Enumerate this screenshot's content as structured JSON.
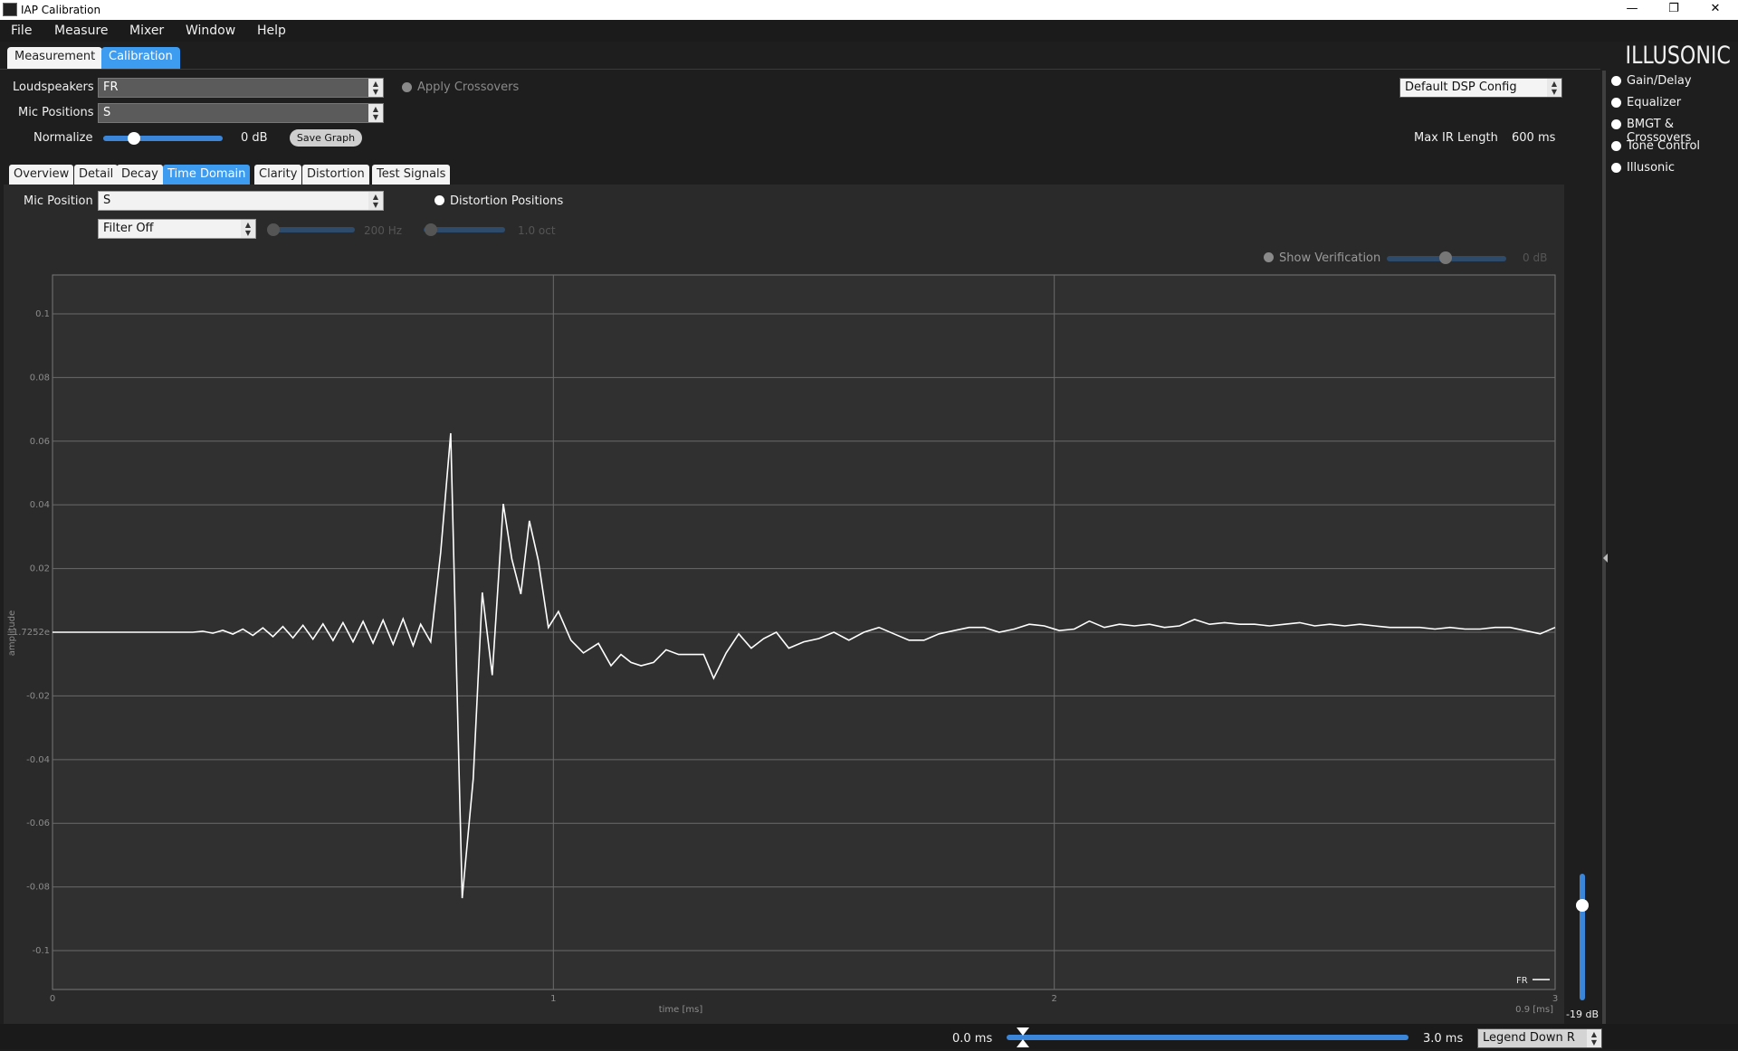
{
  "window": {
    "title": "IAP Calibration"
  },
  "menu": [
    "File",
    "Measure",
    "Mixer",
    "Window",
    "Help"
  ],
  "main_tabs": [
    "Measurement",
    "Calibration"
  ],
  "brand": "ILLUSONIC",
  "controls": {
    "loudspeakers_label": "Loudspeakers",
    "loudspeakers_value": "FR",
    "mic_positions_label": "Mic Positions",
    "mic_positions_value": "S",
    "apply_crossovers": "Apply Crossovers",
    "normalize_label": "Normalize",
    "normalize_value": "0 dB",
    "save_graph": "Save Graph",
    "dsp_config": "Default DSP Config",
    "max_ir_label": "Max IR Length",
    "max_ir_value": "600 ms"
  },
  "sub_tabs": [
    "Overview",
    "Detail",
    "Decay",
    "Time Domain",
    "Clarity",
    "Distortion",
    "Test Signals"
  ],
  "time_domain": {
    "mic_position_label": "Mic Position",
    "mic_position_value": "S",
    "distortion_positions": "Distortion Positions",
    "filter_value": "Filter Off",
    "freq_value": "200 Hz",
    "oct_value": "1.0 oct",
    "show_verification": "Show Verification",
    "verification_db": "0 dB"
  },
  "side_panel": [
    "Gain/Delay",
    "Equalizer",
    "BMGT & Crossovers",
    "Tone Control",
    "Illusonic"
  ],
  "vertical_slider_value": "-19 dB",
  "bottom": {
    "start": "0.0 ms",
    "end": "3.0 ms",
    "legend_select": "Legend Down R"
  },
  "chart_data": {
    "type": "line",
    "title": "",
    "xlabel": "time [ms]",
    "ylabel": "amplitude",
    "xlim": [
      0,
      3
    ],
    "ylim": [
      -0.1122,
      0.1122
    ],
    "x_ticks": [
      "0",
      "1",
      "2",
      "3"
    ],
    "y_ticks": [
      "0.1",
      "0.08",
      "0.06",
      "0.04",
      "0.02",
      "-1.7252e",
      "-0.02",
      "-0.04",
      "-0.06",
      "-0.08",
      "-0.1"
    ],
    "corner_label": "0.9 [ms]",
    "legend": [
      "FR"
    ],
    "series": [
      {
        "name": "FR",
        "points": [
          [
            0.0,
            0.0
          ],
          [
            0.04,
            0.0
          ],
          [
            0.08,
            0.0
          ],
          [
            0.12,
            0.0
          ],
          [
            0.16,
            0.0
          ],
          [
            0.2,
            0.0
          ],
          [
            0.24,
            0.0
          ],
          [
            0.28,
            0.0
          ],
          [
            0.3,
            0.0003
          ],
          [
            0.32,
            -0.0003
          ],
          [
            0.34,
            0.0006
          ],
          [
            0.36,
            -0.0006
          ],
          [
            0.38,
            0.001
          ],
          [
            0.4,
            -0.001
          ],
          [
            0.42,
            0.0014
          ],
          [
            0.44,
            -0.0014
          ],
          [
            0.46,
            0.0018
          ],
          [
            0.48,
            -0.0018
          ],
          [
            0.5,
            0.0022
          ],
          [
            0.52,
            -0.0022
          ],
          [
            0.54,
            0.0026
          ],
          [
            0.56,
            -0.0026
          ],
          [
            0.58,
            0.003
          ],
          [
            0.6,
            -0.003
          ],
          [
            0.62,
            0.0034
          ],
          [
            0.64,
            -0.0034
          ],
          [
            0.66,
            0.0038
          ],
          [
            0.68,
            -0.0038
          ],
          [
            0.7,
            0.0042
          ],
          [
            0.72,
            -0.0042
          ],
          [
            0.735,
            0.0025
          ],
          [
            0.755,
            -0.003
          ],
          [
            0.775,
            0.025
          ],
          [
            0.795,
            0.0625
          ],
          [
            0.818,
            -0.0835
          ],
          [
            0.84,
            -0.046
          ],
          [
            0.858,
            0.0125
          ],
          [
            0.878,
            -0.0135
          ],
          [
            0.9,
            0.0403
          ],
          [
            0.917,
            0.023
          ],
          [
            0.935,
            0.012
          ],
          [
            0.952,
            0.035
          ],
          [
            0.97,
            0.0225
          ],
          [
            0.99,
            0.0015
          ],
          [
            1.01,
            0.0065
          ],
          [
            1.035,
            -0.0025
          ],
          [
            1.06,
            -0.0065
          ],
          [
            1.09,
            -0.0035
          ],
          [
            1.115,
            -0.0105
          ],
          [
            1.135,
            -0.007
          ],
          [
            1.155,
            -0.0095
          ],
          [
            1.175,
            -0.0105
          ],
          [
            1.2,
            -0.0095
          ],
          [
            1.225,
            -0.0055
          ],
          [
            1.25,
            -0.007
          ],
          [
            1.275,
            -0.007
          ],
          [
            1.3,
            -0.007
          ],
          [
            1.32,
            -0.0145
          ],
          [
            1.345,
            -0.0065
          ],
          [
            1.37,
            -0.0005
          ],
          [
            1.395,
            -0.005
          ],
          [
            1.42,
            -0.002
          ],
          [
            1.445,
            0.0
          ],
          [
            1.47,
            -0.005
          ],
          [
            1.5,
            -0.003
          ],
          [
            1.53,
            -0.002
          ],
          [
            1.56,
            0.0
          ],
          [
            1.59,
            -0.0025
          ],
          [
            1.62,
            0.0
          ],
          [
            1.65,
            0.0015
          ],
          [
            1.68,
            -0.0005
          ],
          [
            1.71,
            -0.0025
          ],
          [
            1.74,
            -0.0025
          ],
          [
            1.77,
            -0.0005
          ],
          [
            1.8,
            0.0005
          ],
          [
            1.83,
            0.0015
          ],
          [
            1.86,
            0.0015
          ],
          [
            1.89,
            0.0
          ],
          [
            1.92,
            0.001
          ],
          [
            1.95,
            0.0025
          ],
          [
            1.98,
            0.002
          ],
          [
            2.01,
            0.0005
          ],
          [
            2.04,
            0.001
          ],
          [
            2.07,
            0.0035
          ],
          [
            2.1,
            0.0015
          ],
          [
            2.13,
            0.0025
          ],
          [
            2.16,
            0.002
          ],
          [
            2.19,
            0.0025
          ],
          [
            2.22,
            0.0015
          ],
          [
            2.25,
            0.002
          ],
          [
            2.28,
            0.004
          ],
          [
            2.31,
            0.0025
          ],
          [
            2.34,
            0.003
          ],
          [
            2.37,
            0.0025
          ],
          [
            2.4,
            0.0025
          ],
          [
            2.43,
            0.002
          ],
          [
            2.46,
            0.0025
          ],
          [
            2.49,
            0.003
          ],
          [
            2.52,
            0.002
          ],
          [
            2.55,
            0.0025
          ],
          [
            2.58,
            0.002
          ],
          [
            2.61,
            0.0025
          ],
          [
            2.64,
            0.002
          ],
          [
            2.67,
            0.0015
          ],
          [
            2.7,
            0.0015
          ],
          [
            2.73,
            0.0015
          ],
          [
            2.76,
            0.001
          ],
          [
            2.79,
            0.0015
          ],
          [
            2.82,
            0.001
          ],
          [
            2.85,
            0.001
          ],
          [
            2.88,
            0.0015
          ],
          [
            2.91,
            0.0015
          ],
          [
            2.94,
            0.0005
          ],
          [
            2.97,
            -0.0005
          ],
          [
            3.0,
            0.0015
          ]
        ]
      }
    ],
    "grid": true,
    "legend_position": "bottom-right",
    "colors": {
      "line": "#ffffff",
      "background": "#303030",
      "grid": "#6a6a6a"
    }
  },
  "colors": {
    "accent": "#3d9bf0",
    "background": "#1e1e1e",
    "panel": "#2a2a2a"
  }
}
